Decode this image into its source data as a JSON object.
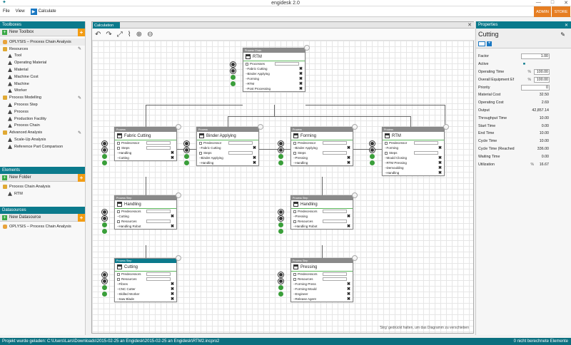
{
  "app": {
    "title": "engidesk 2.0",
    "win_minimize": "—",
    "win_maximize": "□",
    "win_close": "✕"
  },
  "menu": {
    "file": "File",
    "view": "View",
    "calculate": "Calculate"
  },
  "user_buttons": {
    "admin": "ADMIN",
    "store": "STORE"
  },
  "toolboxes": {
    "header": "Toolboxes",
    "new_label": "New Toolbox",
    "current": "OPLYSIS – Process Chain Analysis",
    "items": [
      {
        "label": "Resources",
        "icon": "folder-icon",
        "indent": 0,
        "editable": true
      },
      {
        "label": "Tool",
        "icon": "tool-icon",
        "indent": 1
      },
      {
        "label": "Operating Material",
        "icon": "material-icon",
        "indent": 1
      },
      {
        "label": "Material",
        "icon": "material-icon",
        "indent": 1
      },
      {
        "label": "Machine Cost",
        "icon": "machine-cost-icon",
        "indent": 1
      },
      {
        "label": "Machine",
        "icon": "machine-icon",
        "indent": 1
      },
      {
        "label": "Worker",
        "icon": "worker-icon",
        "indent": 1
      },
      {
        "label": "Process Modelling",
        "icon": "folder-icon",
        "indent": 0,
        "editable": true
      },
      {
        "label": "Process Step",
        "icon": "process-icon",
        "indent": 1
      },
      {
        "label": "Process",
        "icon": "process-icon",
        "indent": 1
      },
      {
        "label": "Production Facility",
        "icon": "facility-icon",
        "indent": 1
      },
      {
        "label": "Process Chain",
        "icon": "process-icon",
        "indent": 1
      },
      {
        "label": "Advanced Analysis",
        "icon": "folder-icon",
        "indent": 0,
        "editable": true
      },
      {
        "label": "Scale-Up Analysis",
        "icon": "analysis-icon",
        "indent": 1
      },
      {
        "label": "Reference Part Comparison",
        "icon": "analysis-icon",
        "indent": 1
      }
    ]
  },
  "elements": {
    "header": "Elements",
    "new_label": "New Folder",
    "items": [
      {
        "label": "Process Chain Analysis",
        "icon": "folder-icon",
        "indent": 0
      },
      {
        "label": "RTM",
        "icon": "process-icon",
        "indent": 1
      }
    ]
  },
  "datasources": {
    "header": "Datasources",
    "new_label": "New Datasource",
    "current": "OPLYSIS – Process Chain Analysis"
  },
  "calculation": {
    "tab": "Calculation",
    "toolbar": [
      "undo-icon",
      "redo-icon",
      "fit-icon",
      "chart-icon",
      "zoom-in-icon",
      "zoom-out-icon"
    ],
    "toolbar_glyphs": [
      "↶",
      "↷",
      "⤢",
      "⌇",
      "⊕",
      "⊖"
    ],
    "hint": "'Strg' gedrückt halten, um das Diagramm zu verschieben"
  },
  "nodes": {
    "rtm_chain": {
      "type": "Process Chain",
      "title": "RTM",
      "rows": [
        "Processes",
        "Fabric Cutting",
        "Binder Applying",
        "Forming",
        "RTM",
        "Post Processing"
      ]
    },
    "fabric_cutting": {
      "type": "Process",
      "title": "Fabric Cutting",
      "rows": [
        "Predecessor",
        "Steps",
        "Handling",
        "Cutting"
      ]
    },
    "binder_applying": {
      "type": "Process",
      "title": "Binder Applying",
      "rows": [
        "Predecessor",
        "Fabric Cutting",
        "Steps",
        "Binder Applying",
        "Handling"
      ]
    },
    "forming": {
      "type": "Process",
      "title": "Forming",
      "rows": [
        "Predecessor",
        "Binder Applying",
        "Steps",
        "Pressing",
        "Handling"
      ]
    },
    "rtm_process": {
      "type": "Process",
      "title": "RTM",
      "rows": [
        "Predecessor",
        "Forming",
        "Steps",
        "Mould Closing",
        "RTM Pressing",
        "Demoulding",
        "Handling"
      ]
    },
    "handling_1": {
      "type": "Process Step",
      "title": "Handling",
      "rows": [
        "Predecessors",
        "Cutting",
        "Resources",
        "Handling Robot"
      ]
    },
    "handling_2": {
      "type": "Process Step",
      "title": "Handling",
      "rows": [
        "Predecessors",
        "Pressing",
        "Resources",
        "Handling Robot"
      ]
    },
    "cutting": {
      "type": "Process Step",
      "title": "Cutting",
      "rows": [
        "Predecessors",
        "Resources",
        "Fibres",
        "CNC Cutter",
        "Skilled Worker",
        "Saw Blade"
      ]
    },
    "pressing": {
      "type": "Process Step",
      "title": "Pressing",
      "rows": [
        "Predecessors",
        "Resources",
        "Forming Press",
        "Forming Mould",
        "Engineer",
        "Release Agent"
      ]
    }
  },
  "properties": {
    "header": "Properties",
    "selected": "Cutting",
    "rows": [
      {
        "label": "Factor",
        "value": "1.00",
        "input": true
      },
      {
        "label": "Active",
        "value": "■",
        "checkbox": true
      },
      {
        "label": "Operating Time",
        "value": "100.00",
        "input": true,
        "unit": "%"
      },
      {
        "label": "Overall Equipment Ef",
        "value": "100.00",
        "input": true,
        "unit": "%"
      },
      {
        "label": "Priority",
        "value": "0",
        "input": true
      },
      {
        "label": "Material Cost",
        "value": "32.50"
      },
      {
        "label": "Operating Cost",
        "value": "2.69"
      },
      {
        "label": "Output",
        "value": "42,857.14"
      },
      {
        "label": "Throughput Time",
        "value": "10.00"
      },
      {
        "label": "Start Time",
        "value": "0.00"
      },
      {
        "label": "End Time",
        "value": "10.00"
      },
      {
        "label": "Cycle Time",
        "value": "10.00"
      },
      {
        "label": "Cycle Time (Reached",
        "value": "336.00"
      },
      {
        "label": "Waiting Time",
        "value": "0.00"
      },
      {
        "label": "Utilization",
        "value": "16.67",
        "unit": "%"
      }
    ]
  },
  "status": {
    "left": "Projekt wurde geladen: C:\\Users\\Lars\\Downloads\\2015-02-25 an Engidesk\\2015-02-25 an Engidesk\\RTM2.incpro2",
    "right": "0 nicht berechnete Elemente"
  }
}
